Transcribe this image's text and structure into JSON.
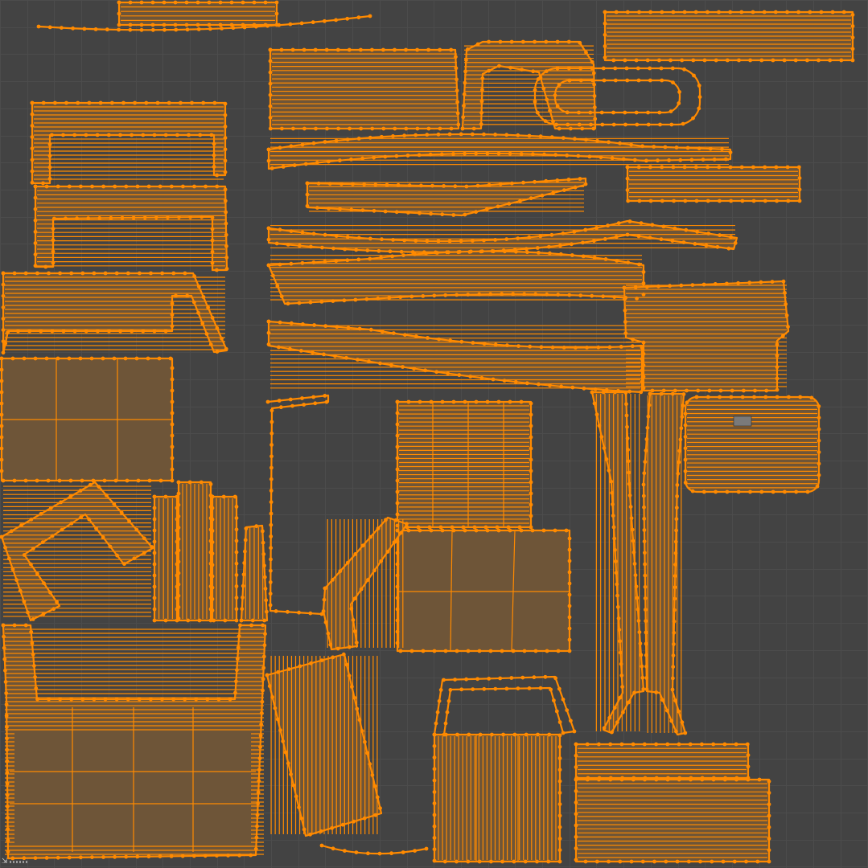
{
  "editor": {
    "name": "UV Editor",
    "background_color": "#434343",
    "grid_color": "#4c4c4c",
    "edge_color": "#ff8a00",
    "face_color": "#6e5538",
    "selection_state": "all-selected"
  },
  "corner_widget": {
    "icon": "resize-arrow-icon"
  }
}
